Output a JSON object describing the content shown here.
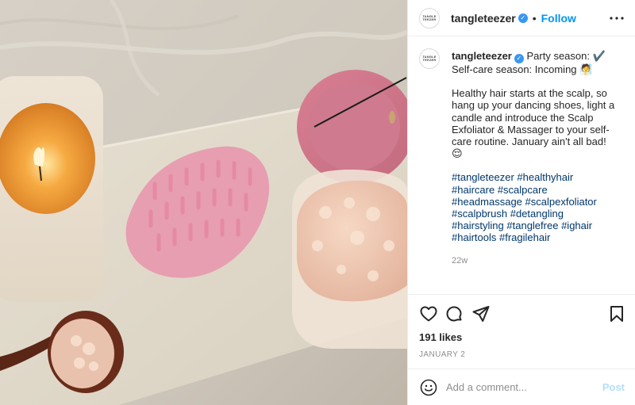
{
  "account": {
    "username": "tangleteezer",
    "avatar_text": "TANGLE TEEZER",
    "verified_mark": "✓",
    "separator": "•",
    "follow_label": "Follow"
  },
  "caption": {
    "first_line": "Party season: ✔️",
    "second_line": "Self-care season: Incoming 🧖",
    "body": "Healthy hair starts at the scalp, so hang up your dancing shoes, light a candle and introduce the Scalp Exfoliator & Massager to your self-care routine. January ain't all bad! 😌",
    "hashtags": [
      "#tangleteezer",
      "#healthyhair",
      "#haircare",
      "#scalpcare",
      "#headmassage",
      "#scalpexfoliator",
      "#scalpbrush",
      "#detangling",
      "#hairstyling",
      "#tanglefree",
      "#ighair",
      "#hairtools",
      "#fragilehair"
    ],
    "age": "22w"
  },
  "engagement": {
    "likes": "191 likes",
    "date": "JANUARY 2"
  },
  "comment_box": {
    "placeholder": "Add a comment...",
    "post_label": "Post"
  },
  "icons": {
    "more": "more-options-icon",
    "like": "heart-icon",
    "comment": "comment-icon",
    "share": "paper-plane-icon",
    "save": "bookmark-icon",
    "emoji": "emoji-icon"
  },
  "colors": {
    "link_blue": "#0095f6",
    "hashtag": "#00376b",
    "muted": "#8e8e8e",
    "post_disabled": "#b2dffc",
    "verified": "#3897f0"
  }
}
